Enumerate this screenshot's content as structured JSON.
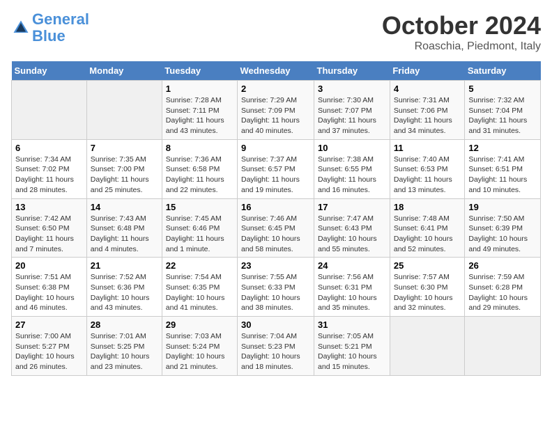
{
  "header": {
    "logo_line1": "General",
    "logo_line2": "Blue",
    "month": "October 2024",
    "location": "Roaschia, Piedmont, Italy"
  },
  "days_of_week": [
    "Sunday",
    "Monday",
    "Tuesday",
    "Wednesday",
    "Thursday",
    "Friday",
    "Saturday"
  ],
  "weeks": [
    [
      {
        "day": "",
        "info": ""
      },
      {
        "day": "",
        "info": ""
      },
      {
        "day": "1",
        "info": "Sunrise: 7:28 AM\nSunset: 7:11 PM\nDaylight: 11 hours and 43 minutes."
      },
      {
        "day": "2",
        "info": "Sunrise: 7:29 AM\nSunset: 7:09 PM\nDaylight: 11 hours and 40 minutes."
      },
      {
        "day": "3",
        "info": "Sunrise: 7:30 AM\nSunset: 7:07 PM\nDaylight: 11 hours and 37 minutes."
      },
      {
        "day": "4",
        "info": "Sunrise: 7:31 AM\nSunset: 7:06 PM\nDaylight: 11 hours and 34 minutes."
      },
      {
        "day": "5",
        "info": "Sunrise: 7:32 AM\nSunset: 7:04 PM\nDaylight: 11 hours and 31 minutes."
      }
    ],
    [
      {
        "day": "6",
        "info": "Sunrise: 7:34 AM\nSunset: 7:02 PM\nDaylight: 11 hours and 28 minutes."
      },
      {
        "day": "7",
        "info": "Sunrise: 7:35 AM\nSunset: 7:00 PM\nDaylight: 11 hours and 25 minutes."
      },
      {
        "day": "8",
        "info": "Sunrise: 7:36 AM\nSunset: 6:58 PM\nDaylight: 11 hours and 22 minutes."
      },
      {
        "day": "9",
        "info": "Sunrise: 7:37 AM\nSunset: 6:57 PM\nDaylight: 11 hours and 19 minutes."
      },
      {
        "day": "10",
        "info": "Sunrise: 7:38 AM\nSunset: 6:55 PM\nDaylight: 11 hours and 16 minutes."
      },
      {
        "day": "11",
        "info": "Sunrise: 7:40 AM\nSunset: 6:53 PM\nDaylight: 11 hours and 13 minutes."
      },
      {
        "day": "12",
        "info": "Sunrise: 7:41 AM\nSunset: 6:51 PM\nDaylight: 11 hours and 10 minutes."
      }
    ],
    [
      {
        "day": "13",
        "info": "Sunrise: 7:42 AM\nSunset: 6:50 PM\nDaylight: 11 hours and 7 minutes."
      },
      {
        "day": "14",
        "info": "Sunrise: 7:43 AM\nSunset: 6:48 PM\nDaylight: 11 hours and 4 minutes."
      },
      {
        "day": "15",
        "info": "Sunrise: 7:45 AM\nSunset: 6:46 PM\nDaylight: 11 hours and 1 minute."
      },
      {
        "day": "16",
        "info": "Sunrise: 7:46 AM\nSunset: 6:45 PM\nDaylight: 10 hours and 58 minutes."
      },
      {
        "day": "17",
        "info": "Sunrise: 7:47 AM\nSunset: 6:43 PM\nDaylight: 10 hours and 55 minutes."
      },
      {
        "day": "18",
        "info": "Sunrise: 7:48 AM\nSunset: 6:41 PM\nDaylight: 10 hours and 52 minutes."
      },
      {
        "day": "19",
        "info": "Sunrise: 7:50 AM\nSunset: 6:39 PM\nDaylight: 10 hours and 49 minutes."
      }
    ],
    [
      {
        "day": "20",
        "info": "Sunrise: 7:51 AM\nSunset: 6:38 PM\nDaylight: 10 hours and 46 minutes."
      },
      {
        "day": "21",
        "info": "Sunrise: 7:52 AM\nSunset: 6:36 PM\nDaylight: 10 hours and 43 minutes."
      },
      {
        "day": "22",
        "info": "Sunrise: 7:54 AM\nSunset: 6:35 PM\nDaylight: 10 hours and 41 minutes."
      },
      {
        "day": "23",
        "info": "Sunrise: 7:55 AM\nSunset: 6:33 PM\nDaylight: 10 hours and 38 minutes."
      },
      {
        "day": "24",
        "info": "Sunrise: 7:56 AM\nSunset: 6:31 PM\nDaylight: 10 hours and 35 minutes."
      },
      {
        "day": "25",
        "info": "Sunrise: 7:57 AM\nSunset: 6:30 PM\nDaylight: 10 hours and 32 minutes."
      },
      {
        "day": "26",
        "info": "Sunrise: 7:59 AM\nSunset: 6:28 PM\nDaylight: 10 hours and 29 minutes."
      }
    ],
    [
      {
        "day": "27",
        "info": "Sunrise: 7:00 AM\nSunset: 5:27 PM\nDaylight: 10 hours and 26 minutes."
      },
      {
        "day": "28",
        "info": "Sunrise: 7:01 AM\nSunset: 5:25 PM\nDaylight: 10 hours and 23 minutes."
      },
      {
        "day": "29",
        "info": "Sunrise: 7:03 AM\nSunset: 5:24 PM\nDaylight: 10 hours and 21 minutes."
      },
      {
        "day": "30",
        "info": "Sunrise: 7:04 AM\nSunset: 5:23 PM\nDaylight: 10 hours and 18 minutes."
      },
      {
        "day": "31",
        "info": "Sunrise: 7:05 AM\nSunset: 5:21 PM\nDaylight: 10 hours and 15 minutes."
      },
      {
        "day": "",
        "info": ""
      },
      {
        "day": "",
        "info": ""
      }
    ]
  ]
}
